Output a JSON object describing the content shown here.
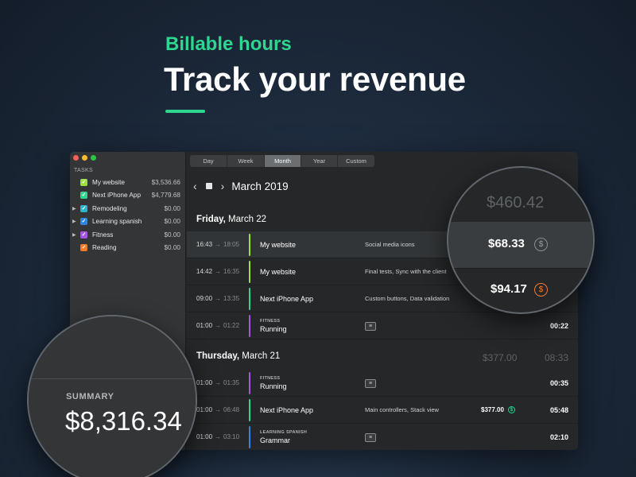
{
  "hero": {
    "eyebrow": "Billable hours",
    "title": "Track your revenue",
    "accent": "#2fd68f"
  },
  "sidebar": {
    "heading": "TASKS",
    "tasks": [
      {
        "name": "My website",
        "amount": "$3,536.66",
        "color": "#9be23a",
        "expandable": false
      },
      {
        "name": "Next iPhone App",
        "amount": "$4,779.68",
        "color": "#2fd68f",
        "expandable": false
      },
      {
        "name": "Remodeling",
        "amount": "$0.00",
        "color": "#2bb5c9",
        "expandable": true
      },
      {
        "name": "Learning spanish",
        "amount": "$0.00",
        "color": "#2f86e0",
        "expandable": true
      },
      {
        "name": "Fitness",
        "amount": "$0.00",
        "color": "#a653e6",
        "expandable": true
      },
      {
        "name": "Reading",
        "amount": "$0.00",
        "color": "#f07b2a",
        "expandable": false
      }
    ]
  },
  "toolbar": {
    "tabs": [
      "Day",
      "Week",
      "Month",
      "Year",
      "Custom"
    ],
    "active_tab": "Month"
  },
  "nav": {
    "month": "March 2019"
  },
  "days": [
    {
      "weekday": "Friday,",
      "date": " March 22",
      "total_money": "",
      "total_time": "",
      "entries": [
        {
          "start": "16:43",
          "end": "18:05",
          "category": "",
          "project": "My website",
          "note": "Social media icons",
          "money": "",
          "duration": "",
          "color": "#9be23a"
        },
        {
          "start": "14:42",
          "end": "16:35",
          "category": "",
          "project": "My website",
          "note": "Final tests, Sync with the client",
          "money": "",
          "duration": "",
          "color": "#9be23a"
        },
        {
          "start": "09:00",
          "end": "13:35",
          "category": "",
          "project": "Next iPhone App",
          "note": "Custom buttons, Data validation",
          "money": "",
          "duration": "",
          "color": "#2fd68f"
        },
        {
          "start": "01:00",
          "end": "01:22",
          "category": "FITNESS",
          "project": "Running",
          "note": "",
          "money": "",
          "duration": "00:22",
          "color": "#a653e6"
        }
      ]
    },
    {
      "weekday": "Thursday,",
      "date": " March 21",
      "total_money": "$377.00",
      "total_time": "08:33",
      "entries": [
        {
          "start": "01:00",
          "end": "01:35",
          "category": "FITNESS",
          "project": "Running",
          "note": "",
          "money": "",
          "duration": "00:35",
          "color": "#a653e6"
        },
        {
          "start": "01:00",
          "end": "06:48",
          "category": "",
          "project": "Next iPhone App",
          "note": "Main controllers, Stack view",
          "money": "$377.00",
          "duration": "05:48",
          "color": "#2fd68f"
        },
        {
          "start": "01:00",
          "end": "03:10",
          "category": "LEARNING SPANISH",
          "project": "Grammar",
          "note": "",
          "money": "",
          "duration": "02:10",
          "color": "#2f86e0"
        }
      ]
    }
  ],
  "summary": {
    "label": "SUMMARY",
    "value": "$8,316.34"
  },
  "money_lens": {
    "day_total": "$460.42",
    "amount_1": "$68.33",
    "amount_2": "$94.17"
  },
  "arrow_glyph": "→",
  "icons": {
    "dollar": "$",
    "note": "note-icon"
  }
}
